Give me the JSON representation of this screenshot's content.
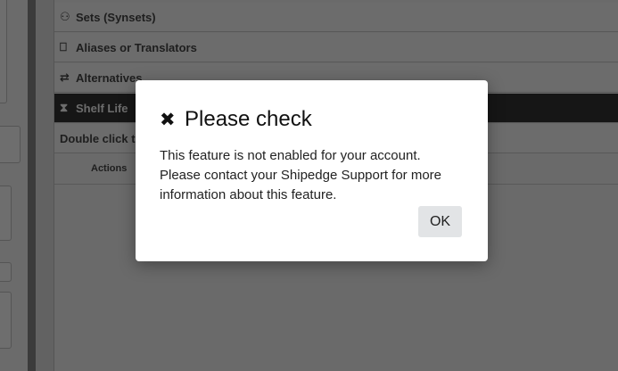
{
  "background": {
    "rows": [
      {
        "label": "Sets (Synsets)",
        "icon": "sets-icon"
      },
      {
        "label": "Aliases or Translators",
        "icon": "aliases-icon"
      },
      {
        "label": "Alternatives",
        "icon": "alternatives-icon"
      },
      {
        "label": "Shelf Life",
        "icon": "hourglass-icon",
        "active": true
      },
      {
        "label": "Double click to"
      }
    ],
    "actions_header": "Actions"
  },
  "dialog": {
    "title": "Please check",
    "title_icon": "close-icon",
    "message": "This feature is not enabled for your account. Please contact your Shipedge Support for more information about this feature.",
    "ok_label": "OK"
  }
}
